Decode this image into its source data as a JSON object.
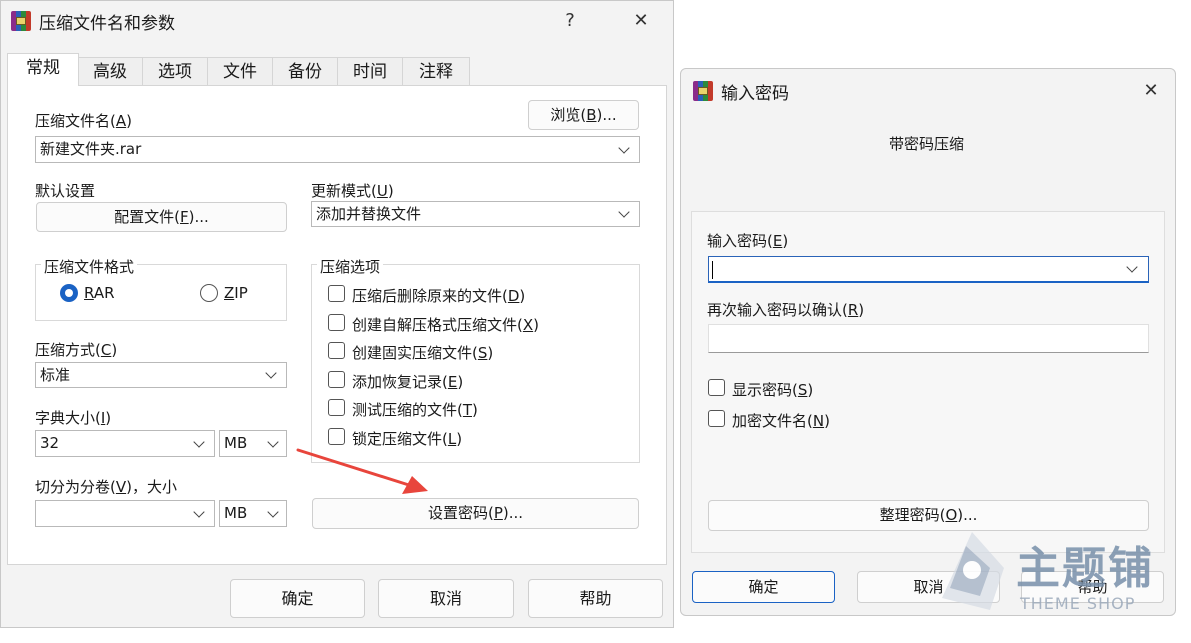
{
  "main_dialog": {
    "title": "压缩文件名和参数",
    "help_glyph": "?",
    "close_glyph": "✕",
    "tabs": [
      "常规",
      "高级",
      "选项",
      "文件",
      "备份",
      "时间",
      "注释"
    ],
    "archive_name_label": "压缩文件名(A)",
    "browse_button": "浏览(B)...",
    "archive_name_value": "新建文件夹.rar",
    "default_settings_label": "默认设置",
    "profiles_button": "配置文件(F)...",
    "update_mode_label": "更新模式(U)",
    "update_mode_value": "添加并替换文件",
    "format_group_label": "压缩文件格式",
    "format_rar": "RAR",
    "format_zip": "ZIP",
    "method_label": "压缩方式(C)",
    "method_value": "标准",
    "dict_label": "字典大小(I)",
    "dict_value": "32",
    "dict_unit": "MB",
    "split_label": "切分为分卷(V)，大小",
    "split_value": "",
    "split_unit": "MB",
    "options_group_label": "压缩选项",
    "options": [
      "压缩后删除原来的文件(D)",
      "创建自解压格式压缩文件(X)",
      "创建固实压缩文件(S)",
      "添加恢复记录(E)",
      "测试压缩的文件(T)",
      "锁定压缩文件(L)"
    ],
    "set_password_button": "设置密码(P)...",
    "ok_button": "确定",
    "cancel_button": "取消",
    "help_button": "帮助"
  },
  "password_dialog": {
    "title": "输入密码",
    "close_glyph": "✕",
    "subtitle": "带密码压缩",
    "enter_label": "输入密码(E)",
    "reenter_label": "再次输入密码以确认(R)",
    "show_password": "显示密码(S)",
    "encrypt_names": "加密文件名(N)",
    "organize_button": "整理密码(O)...",
    "ok_button": "确定",
    "cancel_button": "取消",
    "help_button": "帮助"
  },
  "watermark": {
    "name": "主题铺",
    "sub": "THEME SHOP"
  },
  "colors": {
    "accent": "#1a62c4",
    "arrow": "#e8453c",
    "watermark": "#b8c4d4"
  }
}
